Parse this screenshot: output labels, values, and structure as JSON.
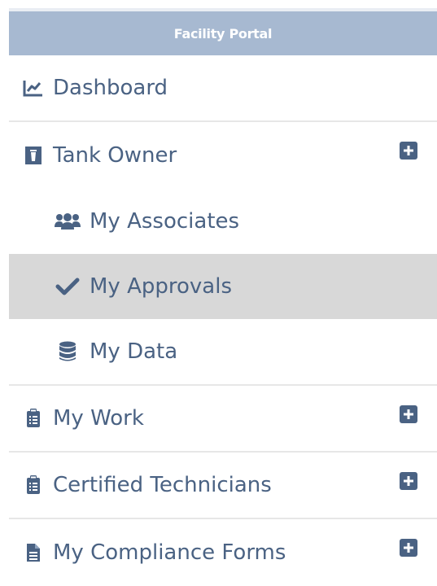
{
  "header": {
    "title": "Facility Portal"
  },
  "nav": {
    "dashboard": {
      "label": "Dashboard",
      "icon": "line-chart-icon"
    },
    "tank_owner": {
      "label": "Tank Owner",
      "icon": "tank-owner-icon",
      "expand_icon": "plus-square-icon"
    },
    "my_associates": {
      "label": "My Associates",
      "icon": "users-icon"
    },
    "my_approvals": {
      "label": "My Approvals",
      "icon": "check-icon",
      "active": true
    },
    "my_data": {
      "label": "My Data",
      "icon": "database-icon"
    },
    "my_work": {
      "label": "My Work",
      "icon": "clipboard-list-icon",
      "expand_icon": "plus-square-icon"
    },
    "certified_technicians": {
      "label": "Certified Technicians",
      "icon": "clipboard-list-icon",
      "expand_icon": "plus-square-icon"
    },
    "my_compliance_forms": {
      "label": "My Compliance Forms",
      "icon": "file-text-icon",
      "expand_icon": "plus-square-icon"
    }
  },
  "colors": {
    "header_bg": "#a7b9d1",
    "text": "#4a6283",
    "active_bg": "#d8d8d8",
    "divider": "#e7e7e7"
  }
}
